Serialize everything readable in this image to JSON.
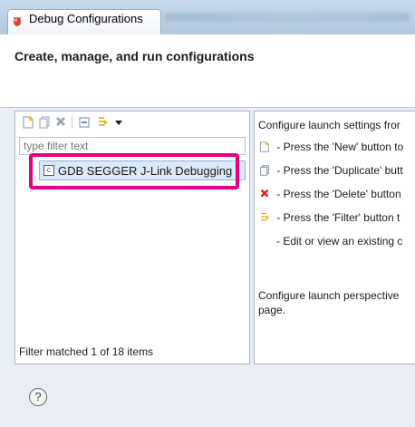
{
  "window": {
    "title": "Debug Configurations",
    "icon": "debug-bug-icon"
  },
  "header": {
    "title": "Create, manage, and run configurations"
  },
  "left_panel": {
    "toolbar": {
      "icons": [
        "new-configuration-icon",
        "duplicate-icon",
        "delete-icon",
        "collapse-all-icon",
        "filter-icon",
        "dropdown-arrow-icon"
      ]
    },
    "filter_placeholder": "type filter text",
    "tree_items": [
      {
        "label": "GDB SEGGER J-Link Debugging",
        "icon": "c-launch-icon",
        "icon_letter": "c"
      }
    ],
    "status": "Filter matched 1 of 18 items"
  },
  "right_panel": {
    "lines": [
      "Configure launch settings fror",
      " - Press the 'New' button to",
      " - Press the 'Duplicate' butt",
      " - Press the 'Delete' button",
      " - Press the 'Filter' button t",
      " - Edit or view an existing c",
      "Configure launch perspective",
      "page."
    ]
  },
  "colors": {
    "highlight": "#e5007e",
    "selection": "#dbe8f8"
  }
}
